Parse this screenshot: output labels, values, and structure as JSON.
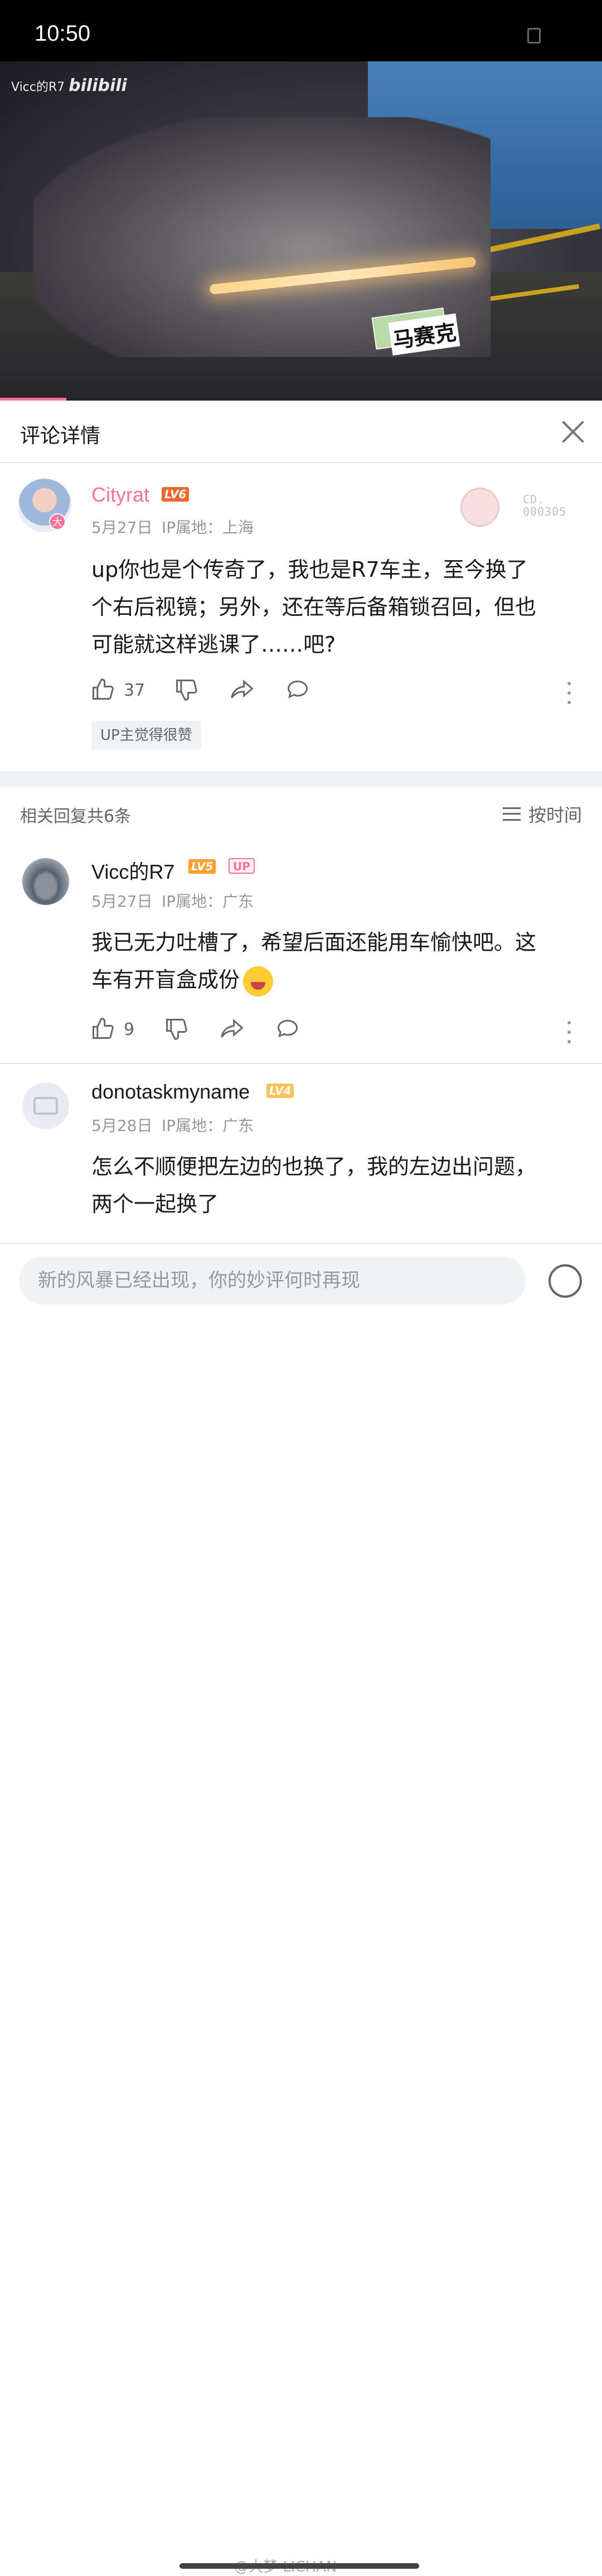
{
  "status_bar": {
    "time": "10:50"
  },
  "video": {
    "watermark_user": "Vicc的R7",
    "watermark_brand": "bilibili",
    "overlay_text": "马赛克",
    "progress_fraction": 0.11
  },
  "detail": {
    "title": "评论详情"
  },
  "main_comment": {
    "username": "Cityrat",
    "level": "LV6",
    "avatar_badge": "大",
    "date": "5月27日",
    "ip_label": "IP属地：上海",
    "text_lines": [
      "up你也是个传奇了，我也是R7车主，至今换了",
      "个右后视镜；另外，还在等后备箱锁召回，但也",
      "可能就这样逃课了……吧?"
    ],
    "likes": "37",
    "up_liked_tag": "UP主觉得很赞",
    "collection_label": [
      "CD.",
      "000305"
    ]
  },
  "replies_header": {
    "count_text": "相关回复共6条",
    "sort_label": "按时间"
  },
  "replies": [
    {
      "username": "Vicc的R7",
      "level": "LV5",
      "up_tag": "UP",
      "date": "5月27日",
      "ip_label": "IP属地：广东",
      "text_lines": [
        "我已无力吐槽了，希望后面还能用车愉快吧。这",
        "车有开盲盒成份"
      ],
      "likes": "9"
    },
    {
      "username": "donotaskmyname",
      "level": "LV4",
      "date": "5月28日",
      "ip_label": "IP属地：广东",
      "text_lines": [
        "怎么不顺便把左边的也换了，我的左边出问题，",
        "两个一起换了"
      ]
    }
  ],
  "input": {
    "placeholder": "新的风暴已经出现，你的妙评何时再现"
  },
  "watermark": "@大梦-LICHAN",
  "colors": {
    "accent_pink": "#fb7299",
    "lv6": "#ee672a",
    "lv5": "#ff9f2f",
    "lv4": "#ffc15a"
  }
}
